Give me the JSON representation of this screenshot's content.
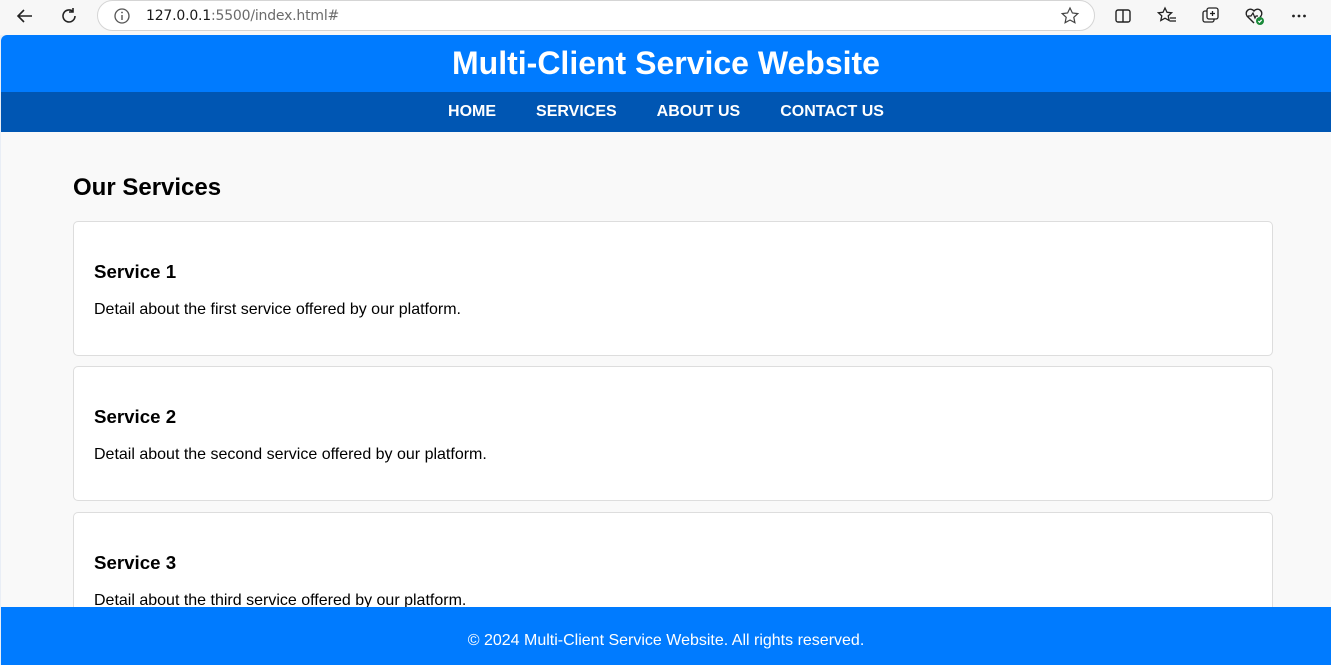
{
  "browser": {
    "url_host": "127.0.0.1",
    "url_path": ":5500/index.html#",
    "icons": [
      "back-arrow-icon",
      "reload-icon",
      "site-info-icon",
      "favorite-star-icon",
      "split-screen-icon",
      "favorites-icon",
      "collections-icon",
      "browser-essentials-icon",
      "more-options-icon"
    ]
  },
  "header": {
    "title": "Multi-Client Service Website"
  },
  "nav": {
    "items": [
      "HOME",
      "SERVICES",
      "ABOUT US",
      "CONTACT US"
    ]
  },
  "main": {
    "section_title": "Our Services",
    "services": [
      {
        "title": "Service 1",
        "description": "Detail about the first service offered by our platform."
      },
      {
        "title": "Service 2",
        "description": "Detail about the second service offered by our platform."
      },
      {
        "title": "Service 3",
        "description": "Detail about the third service offered by our platform."
      }
    ]
  },
  "footer": {
    "text": "© 2024 Multi-Client Service Website. All rights reserved."
  },
  "colors": {
    "header_blue": "#007bff",
    "nav_blue": "#0056b3",
    "page_bg": "#f9f9f9",
    "card_border": "#dddddd"
  }
}
